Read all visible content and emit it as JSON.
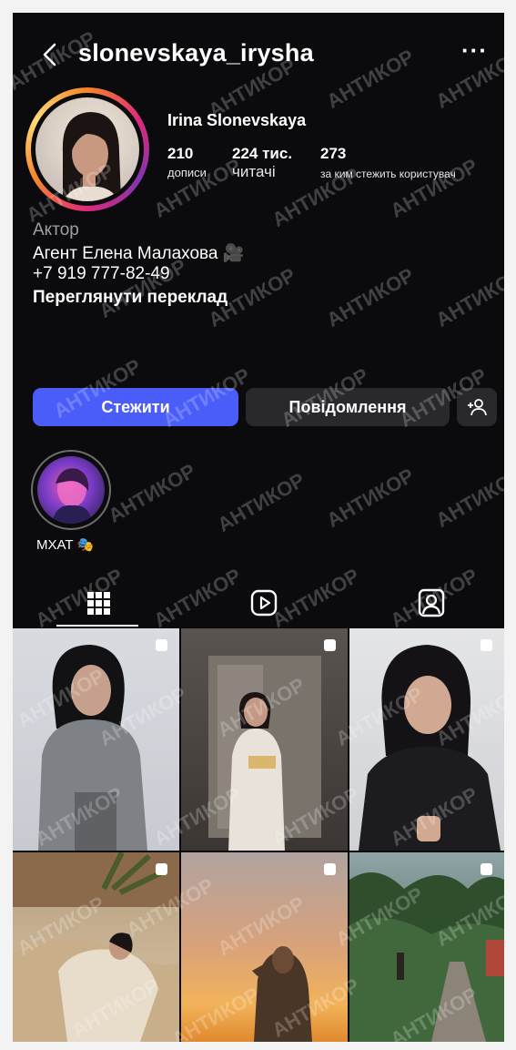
{
  "profile": {
    "username": "slonevskaya_irysha",
    "display_name": "Irina Slonevskaya",
    "posts_count": "210",
    "posts_label": "дописи",
    "followers_count": "224 тис.",
    "followers_label": "читачі",
    "following_count": "273",
    "following_label": "за ким стежить користувач"
  },
  "bio": {
    "category": "Актор",
    "line1": "Агент Елена Малахова 🎥",
    "line2": "+7 919 777-82-49",
    "translate": "Переглянути переклад"
  },
  "actions": {
    "follow": "Стежити",
    "message": "Повідомлення"
  },
  "highlight": {
    "label": "МХАТ 🎭"
  },
  "tabs": [
    {
      "icon": "grid-icon",
      "active": true
    },
    {
      "icon": "reels-icon",
      "active": false
    },
    {
      "icon": "tagged-icon",
      "active": false
    }
  ],
  "watermark": "АНТИКОР",
  "colors": {
    "background": "#0b0b0e",
    "follow_button": "#4a5df9",
    "secondary_button": "#28282d"
  }
}
